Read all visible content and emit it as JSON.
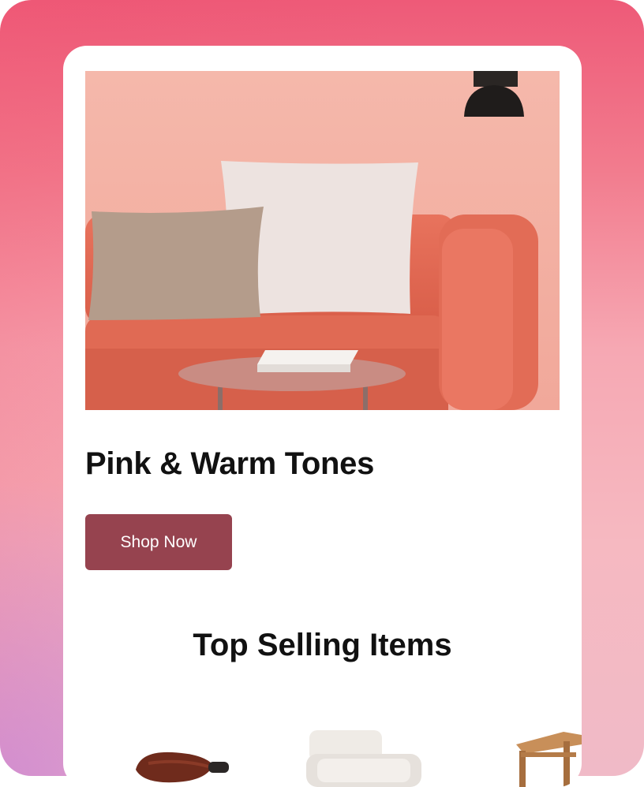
{
  "promo": {
    "title": "Pink & Warm Tones",
    "cta_label": "Shop Now",
    "image_alt": "Coral sofa with pillows, side table and book against a pink wall"
  },
  "top_selling": {
    "title": "Top Selling Items",
    "items": [
      {
        "name": "brown-leather-chair"
      },
      {
        "name": "white-armchair"
      },
      {
        "name": "wooden-side-table"
      }
    ]
  },
  "colors": {
    "accent": "#96434f",
    "hero_wall": "#f4b3a6",
    "sofa": "#e46a55"
  }
}
